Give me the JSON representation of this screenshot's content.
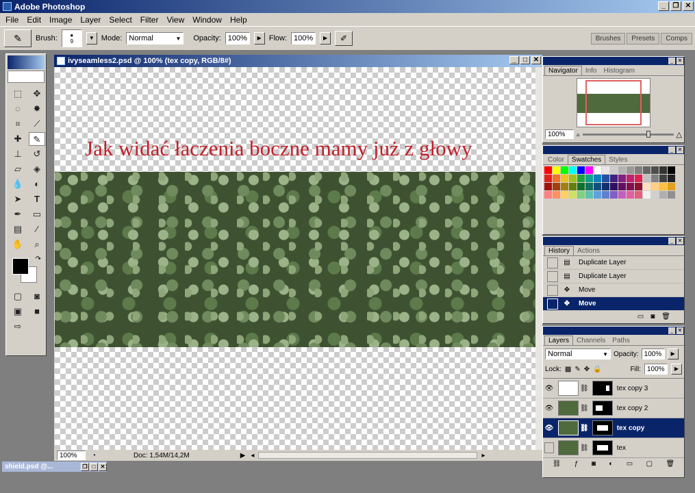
{
  "app": {
    "title": "Adobe Photoshop"
  },
  "menu": [
    "File",
    "Edit",
    "Image",
    "Layer",
    "Select",
    "Filter",
    "View",
    "Window",
    "Help"
  ],
  "options": {
    "brush_label": "Brush:",
    "brush_size": "9",
    "mode_label": "Mode:",
    "mode_value": "Normal",
    "opacity_label": "Opacity:",
    "opacity_value": "100%",
    "flow_label": "Flow:",
    "flow_value": "100%"
  },
  "palette_well": [
    "Brushes",
    "Presets",
    "Comps"
  ],
  "document": {
    "title": "ivyseamless2.psd @ 100% (tex copy, RGB/8#)",
    "caption": "Jak widać łaczenia boczne mamy już z głowy",
    "zoom": "100%",
    "doc_info": "Doc: 1,54M/14,2M"
  },
  "navigator": {
    "tabs": [
      "Navigator",
      "Info",
      "Histogram"
    ],
    "zoom": "100%"
  },
  "swatches": {
    "tabs": [
      "Color",
      "Swatches",
      "Styles"
    ],
    "colors": [
      "#ff0000",
      "#ffff00",
      "#00ff00",
      "#00ffff",
      "#0000ff",
      "#ff00ff",
      "#ffffff",
      "#e6e6e6",
      "#cccccc",
      "#b3b3b3",
      "#999999",
      "#808080",
      "#666666",
      "#4d4d4d",
      "#333333",
      "#000000",
      "#e0201c",
      "#f07030",
      "#f0c020",
      "#a0c020",
      "#20a040",
      "#10a090",
      "#1080c0",
      "#2050a0",
      "#402080",
      "#802080",
      "#c02070",
      "#e02050",
      "#c0c0c0",
      "#808080",
      "#404040",
      "#202020",
      "#a01010",
      "#a04010",
      "#a08010",
      "#608010",
      "#107030",
      "#107060",
      "#105080",
      "#103070",
      "#301060",
      "#601060",
      "#801050",
      "#901030",
      "#ffe0c0",
      "#ffd080",
      "#ffc040",
      "#e0a020",
      "#ff8080",
      "#ff9060",
      "#ffd060",
      "#d0e060",
      "#80d080",
      "#60c0b0",
      "#60a0e0",
      "#6080d0",
      "#8060c0",
      "#c060c0",
      "#e060a0",
      "#e06080",
      "#f0f0f0",
      "#d0d0d0",
      "#b0b0b0",
      "#909090"
    ]
  },
  "history": {
    "tabs": [
      "History",
      "Actions"
    ],
    "items": [
      "Duplicate Layer",
      "Duplicate Layer",
      "Move",
      "Move"
    ]
  },
  "layers": {
    "tabs": [
      "Layers",
      "Channels",
      "Paths"
    ],
    "blend": "Normal",
    "opacity_label": "Opacity:",
    "opacity_value": "100%",
    "lock_label": "Lock:",
    "fill_label": "Fill:",
    "fill_value": "100%",
    "items": [
      "tex copy 3",
      "tex copy 2",
      "tex copy",
      "tex"
    ]
  },
  "minidoc": {
    "title": "shield.psd @..."
  }
}
